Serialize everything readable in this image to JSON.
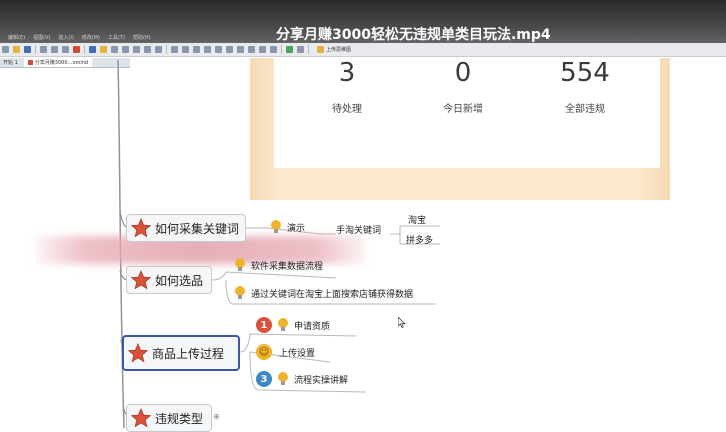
{
  "video": {
    "title": "分享月赚3000轻松无违规单类目玩法.mp4"
  },
  "menubar": {
    "items": [
      "编辑(E)",
      "视图(V)",
      "插入(I)",
      "修改(M)",
      "工具(T)",
      "帮助(H)"
    ]
  },
  "toolbar": {
    "upload_map_label": "上传思维图"
  },
  "tabs": {
    "start_tab": "开始 1",
    "doc_tab": "分享月赚3000…xmind"
  },
  "stats": [
    {
      "value": "3",
      "label": "待处理"
    },
    {
      "value": "0",
      "label": "今日新增"
    },
    {
      "value": "554",
      "label": "全部违规"
    }
  ],
  "mindmap": {
    "topics": {
      "collect_keywords": "如何采集关键词",
      "select_products": "如何选品",
      "upload_process": "商品上传过程",
      "violation_types": "违规类型"
    },
    "leaves": {
      "demo": "演示",
      "taobao_keywords": "手淘关键词",
      "taobao": "淘宝",
      "pinduoduo": "拼多多",
      "software_collect": "软件采集数据流程",
      "keyword_search": "通过关键词在淘宝上面搜索店铺获得数据",
      "apply_qualification": "申请资质",
      "upload_settings": "上传设置",
      "process_demo": "流程实操讲解"
    },
    "markers": {
      "marker1": "1",
      "marker3": "3"
    },
    "colors": {
      "star": "#d9533c",
      "bulb": "#f0b42c",
      "selected_border": "#3a5aa8"
    }
  }
}
